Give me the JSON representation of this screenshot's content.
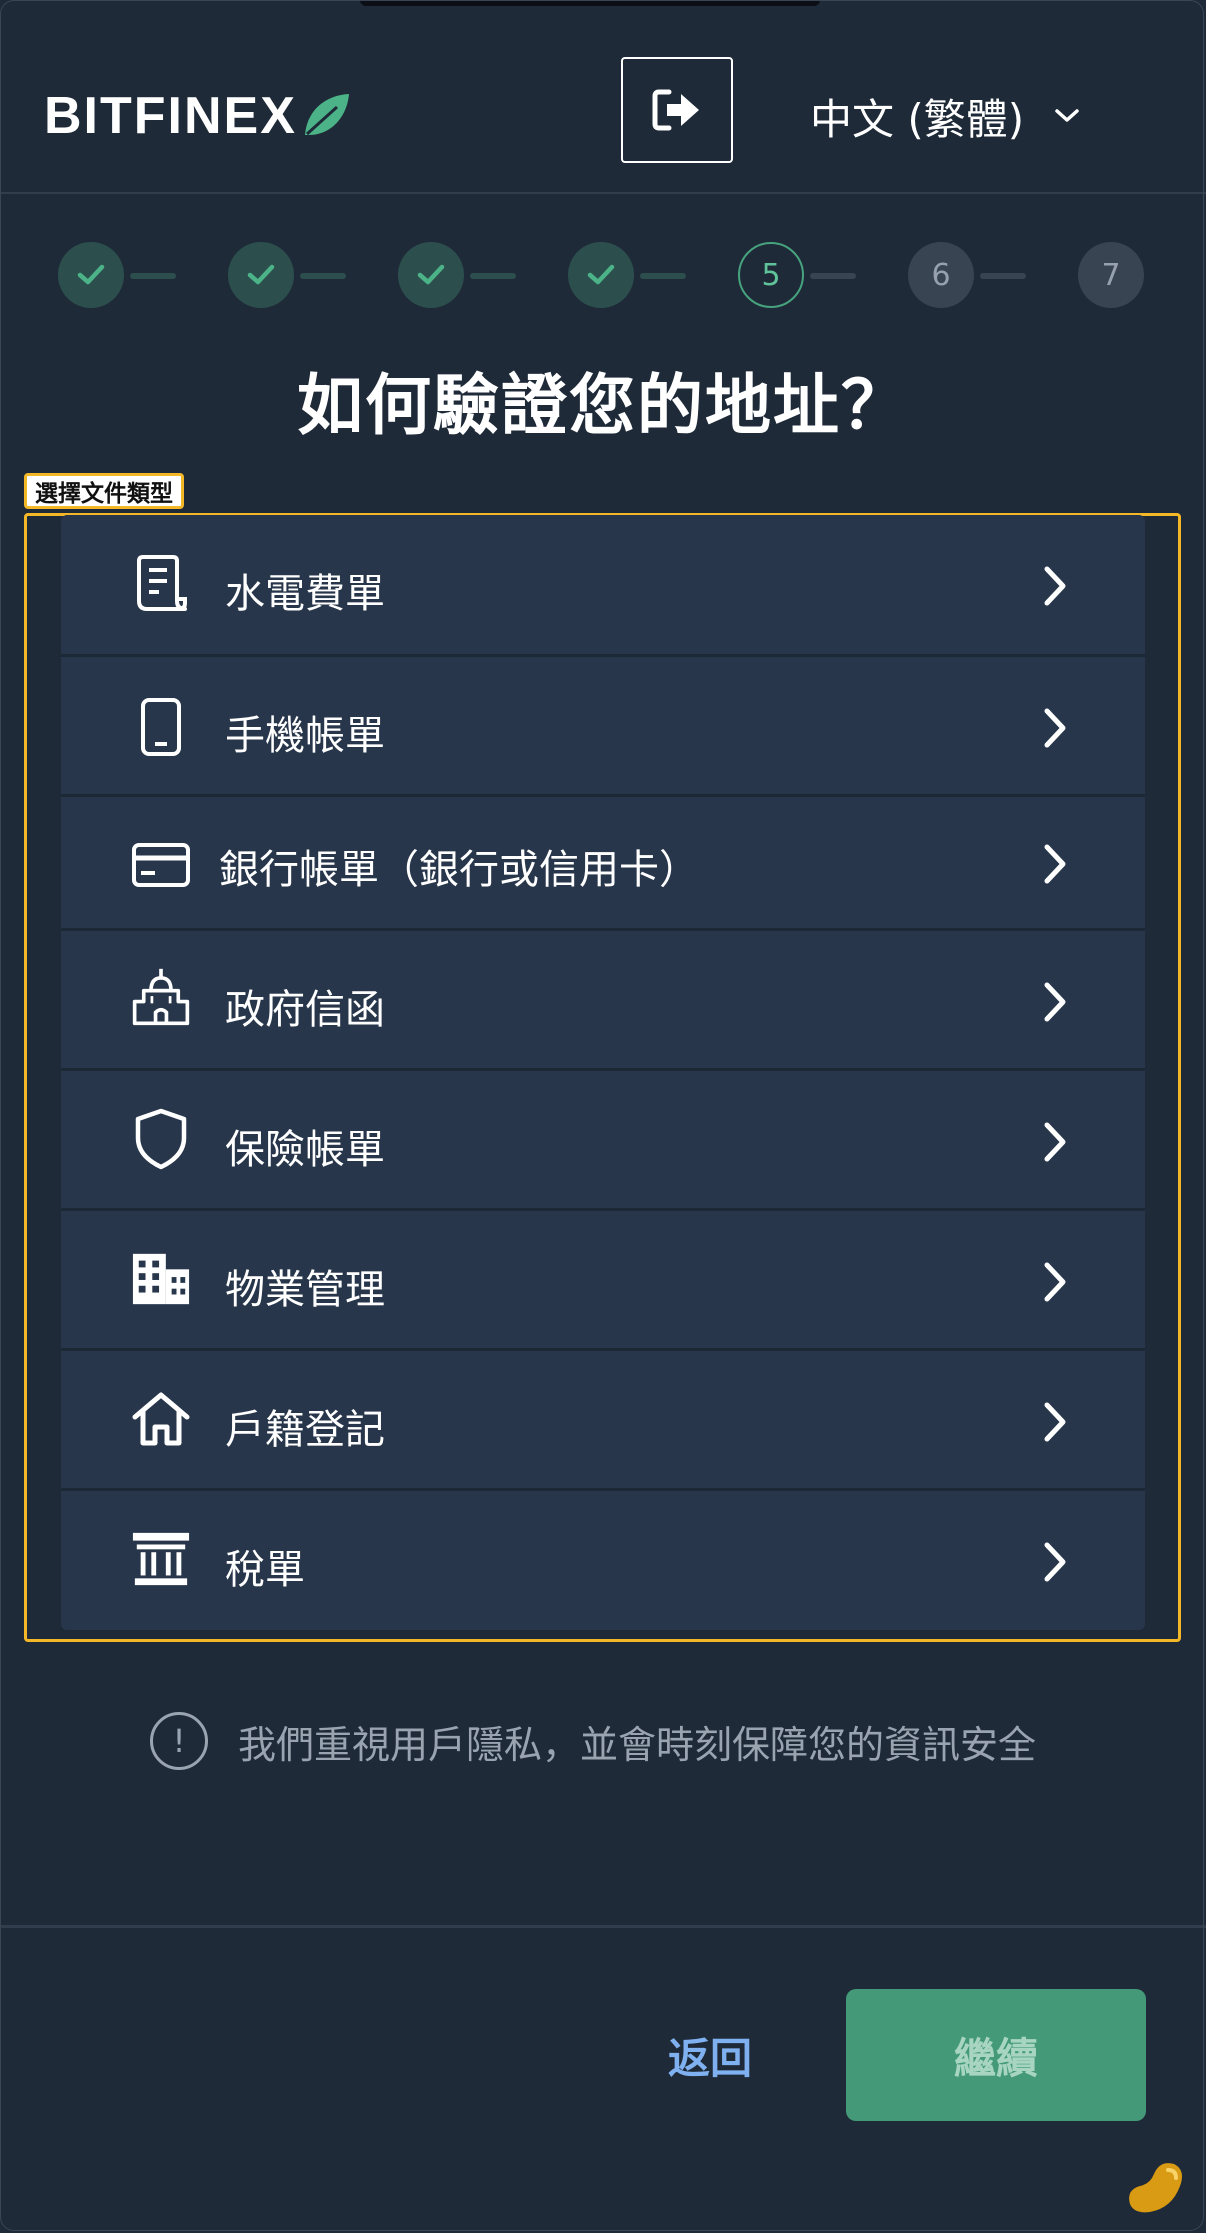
{
  "header": {
    "logo_text": "BITFINEX",
    "logout_icon": "logout-icon",
    "language": "中文 (繁體)",
    "language_icon": "chevron-down-icon"
  },
  "stepper": {
    "steps": [
      {
        "label": "",
        "state": "done"
      },
      {
        "label": "",
        "state": "done"
      },
      {
        "label": "",
        "state": "done"
      },
      {
        "label": "",
        "state": "done"
      },
      {
        "label": "5",
        "state": "current"
      },
      {
        "label": "6",
        "state": "todo"
      },
      {
        "label": "7",
        "state": "todo"
      }
    ]
  },
  "main": {
    "title": "如何驗證您的地址？",
    "highlight_label": "選擇文件類型",
    "options": [
      {
        "label": "水電費單",
        "icon": "receipt-icon"
      },
      {
        "label": "手機帳單",
        "icon": "mobile-phone-icon"
      },
      {
        "label": "銀行帳單（銀行或信用卡）",
        "icon": "credit-card-icon"
      },
      {
        "label": "政府信函",
        "icon": "government-building-icon"
      },
      {
        "label": "保險帳單",
        "icon": "shield-icon"
      },
      {
        "label": "物業管理",
        "icon": "office-building-icon"
      },
      {
        "label": "戶籍登記",
        "icon": "home-icon"
      },
      {
        "label": "稅單",
        "icon": "bank-icon"
      }
    ],
    "privacy_note": "我們重視用戶隱私，並會時刻保障您的資訊安全",
    "privacy_icon": "exclamation-icon"
  },
  "footer": {
    "back_label": "返回",
    "continue_label": "繼續"
  },
  "colors": {
    "background": "#1f2a38",
    "card": "#27364a",
    "accent_green": "#449a78",
    "link_blue": "#7fb0f0",
    "highlight": "#f4b728"
  }
}
